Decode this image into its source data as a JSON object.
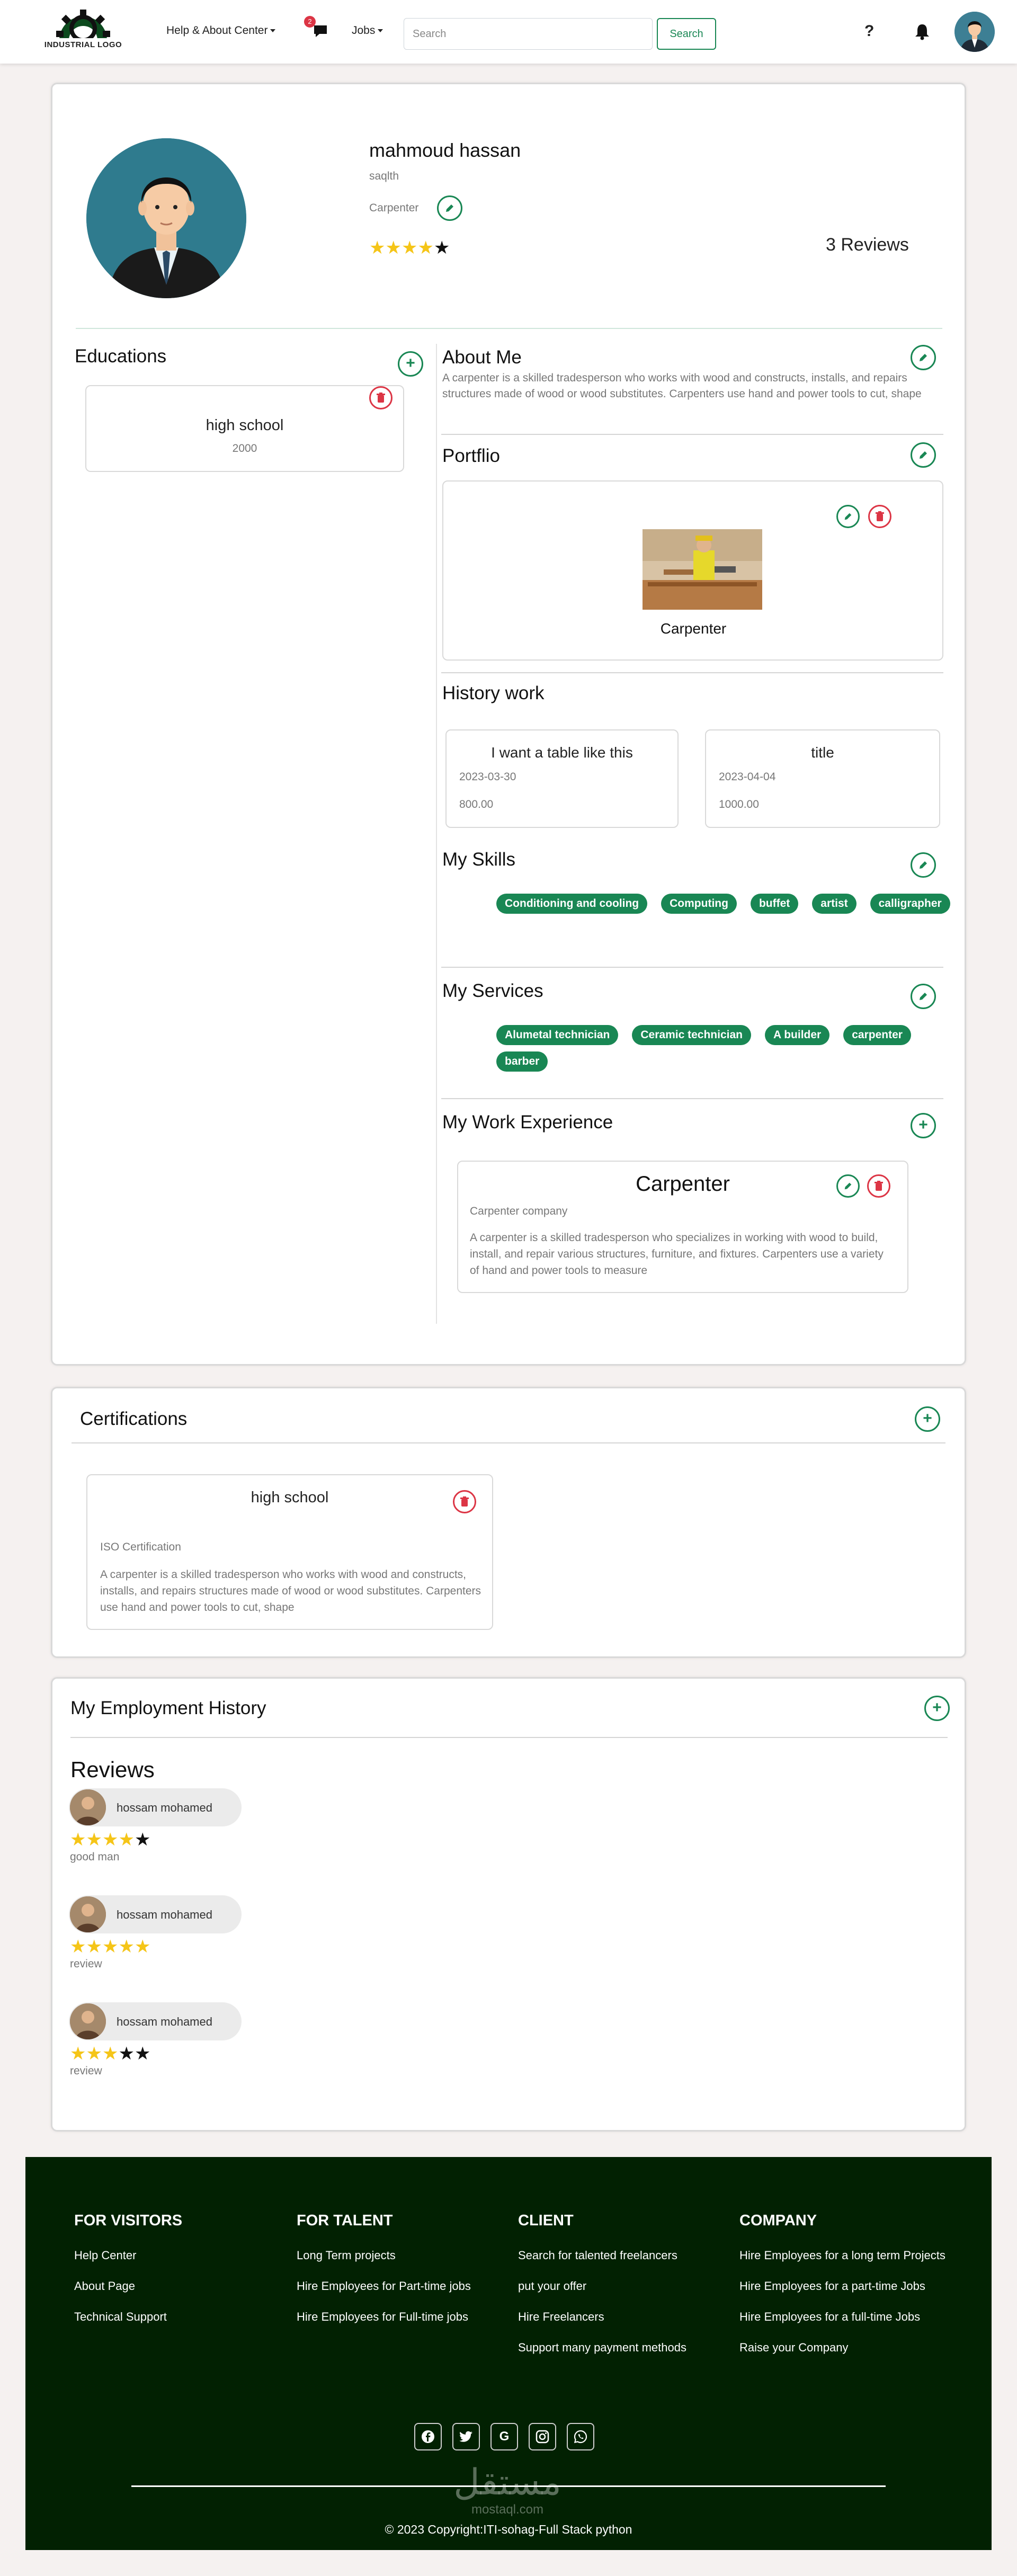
{
  "navbar": {
    "logo_text": "INDUSTRIAL LOGO",
    "help_label": "Help & About Center",
    "messages_badge": "2",
    "jobs_label": "Jobs",
    "search_placeholder": "Search",
    "search_button": "Search",
    "help_icon": "?"
  },
  "profile": {
    "name": "mahmoud hassan",
    "location": "saqlth",
    "title": "Carpenter",
    "rating": 4,
    "rating_max": 5,
    "reviews_count": "3 Reviews"
  },
  "educations": {
    "title": "Educations",
    "items": [
      {
        "name": "high school",
        "year": "2000"
      }
    ]
  },
  "about": {
    "title": "About Me",
    "text": "A carpenter is a skilled tradesperson who works with wood and constructs, installs, and repairs structures made of wood or wood substitutes. Carpenters use hand and power tools to cut, shape"
  },
  "portfolio": {
    "title": "Portflio",
    "items": [
      {
        "caption": "Carpenter"
      }
    ]
  },
  "history": {
    "title": "History work",
    "items": [
      {
        "title": "I want a table like this",
        "date": "2023-03-30",
        "price": "800.00"
      },
      {
        "title": "title",
        "date": "2023-04-04",
        "price": "1000.00"
      }
    ]
  },
  "skills": {
    "title": "My Skills",
    "items": [
      "Conditioning and cooling",
      "Computing",
      "buffet",
      "artist",
      "calligrapher"
    ]
  },
  "services": {
    "title": "My Services",
    "items": [
      "Alumetal technician",
      "Ceramic technician",
      "A builder",
      "carpenter",
      "barber"
    ]
  },
  "experience": {
    "title": "My Work Experience",
    "items": [
      {
        "title": "Carpenter",
        "company": "Carpenter company",
        "description": "A carpenter is a skilled tradesperson who specializes in working with wood to build, install, and repair various structures, furniture, and fixtures. Carpenters use a variety of hand and power tools to measure"
      }
    ]
  },
  "certifications": {
    "title": "Certifications",
    "items": [
      {
        "title": "high school",
        "type": "ISO Certification",
        "description": "A carpenter is a skilled tradesperson who works with wood and constructs, installs, and repairs structures made of wood or wood substitutes. Carpenters use hand and power tools to cut, shape"
      }
    ]
  },
  "employment": {
    "title": "My Employment History"
  },
  "reviews": {
    "title": "Reviews",
    "items": [
      {
        "name": "hossam mohamed",
        "rating": 4,
        "text": "good man"
      },
      {
        "name": "hossam mohamed",
        "rating": 5,
        "text": "review"
      },
      {
        "name": "hossam mohamed",
        "rating": 3,
        "text": "review"
      }
    ]
  },
  "footer": {
    "columns": [
      {
        "heading": "FOR VISITORS",
        "links": [
          "Help Center",
          "About Page",
          "Technical Support"
        ]
      },
      {
        "heading": "FOR TALENT",
        "links": [
          "Long Term projects",
          "Hire Employees for Part-time jobs",
          "Hire Employees for Full-time jobs"
        ]
      },
      {
        "heading": "CLIENT",
        "links": [
          "Search for talented freelancers",
          "put your offer",
          "Hire Freelancers",
          "Support many payment methods"
        ]
      },
      {
        "heading": "COMPANY",
        "links": [
          "Hire Employees for a long term Projects",
          "Hire Employees for a part-time Jobs",
          "Hire Employees for a full-time Jobs",
          "Raise your Company"
        ]
      }
    ],
    "social_icons": [
      "facebook-icon",
      "twitter-icon",
      "google-icon",
      "instagram-icon",
      "whatsapp-icon"
    ],
    "copyright": "© 2023 Copyright:ITI-sohag-Full Stack python",
    "watermark_arabic": "مستقل",
    "watermark_latin": "mostaql.com"
  },
  "colors": {
    "accent": "#198754",
    "danger": "#dc3545",
    "star": "#f5c518",
    "footer_bg": "#022102"
  }
}
